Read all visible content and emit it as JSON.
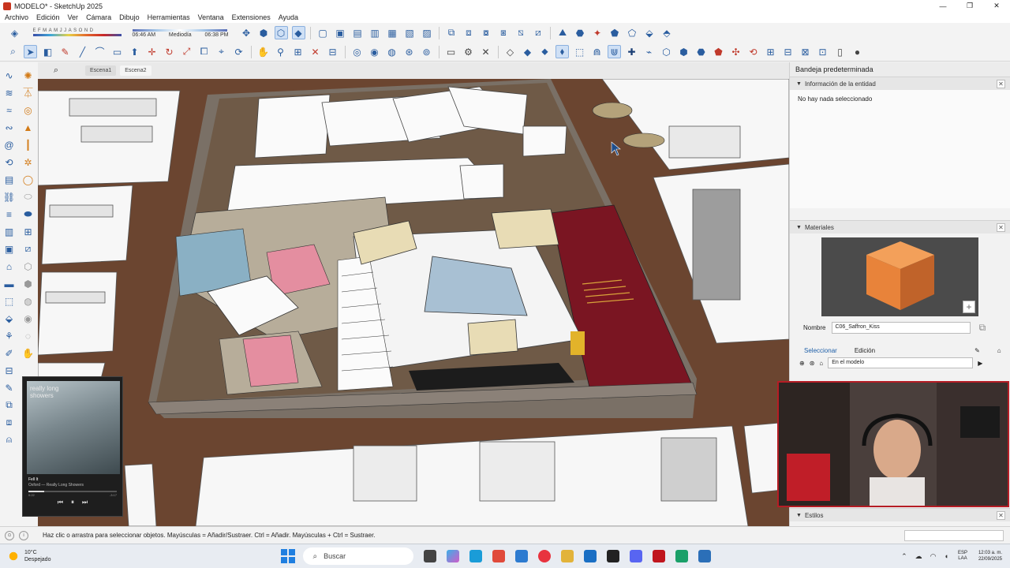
{
  "window": {
    "title": "MODELO* - SketchUp 2025",
    "controls": [
      "—",
      "❐",
      "✕"
    ]
  },
  "menu": {
    "items": [
      "Archivo",
      "Edición",
      "Ver",
      "Cámara",
      "Dibujo",
      "Herramientas",
      "Ventana",
      "Extensiones",
      "Ayuda"
    ]
  },
  "shadows": {
    "months": "EFMAMJJASOND",
    "time_start": "06:46 AM",
    "time_mid": "Mediodía",
    "time_end": "06:38 PM"
  },
  "scenes": {
    "tabs": [
      "Escena1",
      "Escena2"
    ],
    "active_index": 1
  },
  "tray_panel": {
    "title": "Bandeja predeterminada",
    "entity_section": "Información de la entidad",
    "entity_message": "No hay nada seleccionado",
    "materials_section": "Materiales",
    "name_label": "Nombre",
    "material_name": "C06_Saffron_Kiss",
    "tab_select": "Seleccionar",
    "tab_edit": "Edición",
    "collection": "En el modelo",
    "styles_section": "Estilos",
    "material_color": "#E8833A"
  },
  "music_player": {
    "cover_text": "really long showers",
    "track": "Fell It",
    "artist": "Oxford — Really Long Showers",
    "elapsed": "0:22",
    "total": "-3:17",
    "progress": 0.18
  },
  "status": {
    "message": "Haz clic o arrastra para seleccionar objetos. Mayúsculas = Añadir/Sustraer. Ctrl = Añadir. Mayúsculas + Ctrl = Sustraer."
  },
  "taskbar": {
    "temperature": "10°C",
    "weather": "Despejado",
    "search_placeholder": "Buscar",
    "lang_1": "ESP",
    "lang_2": "LAA",
    "time": "12:03 a. m.",
    "date": "22/09/2025"
  }
}
